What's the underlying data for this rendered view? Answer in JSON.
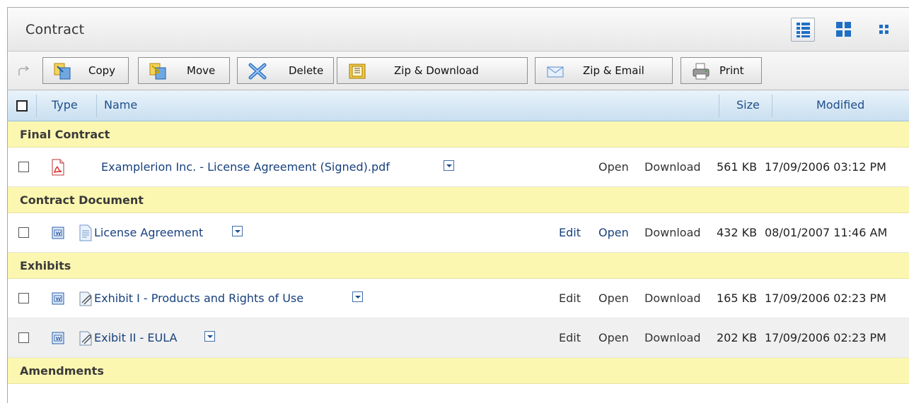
{
  "panel": {
    "title": "Contract"
  },
  "view_buttons": [
    "details-view-icon",
    "large-icons-view-icon",
    "small-icons-view-icon"
  ],
  "toolbar": {
    "copy": "Copy",
    "move": "Move",
    "delete": "Delete",
    "zip_download": "Zip & Download",
    "zip_email": "Zip & Email",
    "print": "Print"
  },
  "columns": {
    "type": "Type",
    "name": "Name",
    "size": "Size",
    "modified": "Modified"
  },
  "groups": [
    {
      "label": "Final Contract",
      "items": [
        {
          "name": "Examplerion Inc. - License Agreement (Signed).pdf",
          "edit": "",
          "open": "Open",
          "download": "Download",
          "size": "561 KB",
          "modified": "17/09/2006 03:12 PM"
        }
      ]
    },
    {
      "label": "Contract Document",
      "items": [
        {
          "name": "License Agreement",
          "edit": "Edit",
          "open": "Open",
          "download": "Download",
          "size": "432 KB",
          "modified": "08/01/2007 11:46 AM"
        }
      ]
    },
    {
      "label": "Exhibits",
      "items": [
        {
          "name": "Exhibit I - Products and Rights of Use",
          "edit": "Edit",
          "open": "Open",
          "download": "Download",
          "size": "165 KB",
          "modified": "17/09/2006 02:23 PM"
        },
        {
          "name": "Exibit II - EULA",
          "edit": "Edit",
          "open": "Open",
          "download": "Download",
          "size": "202 KB",
          "modified": "17/09/2006 02:23 PM"
        }
      ]
    },
    {
      "label": "Amendments",
      "items": []
    }
  ],
  "colors": {
    "group_bg": "#fbf7b0",
    "header_bg": "#c9dff0",
    "link": "#17407d"
  }
}
